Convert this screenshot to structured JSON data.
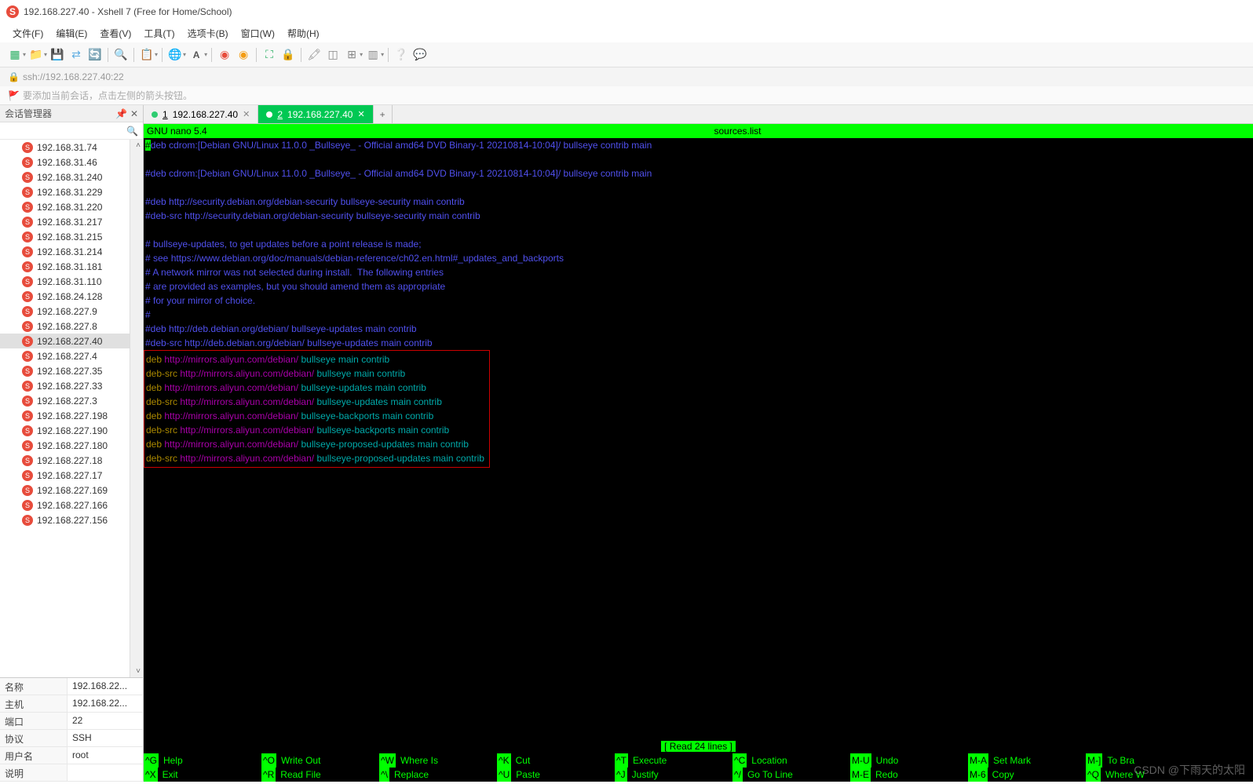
{
  "window": {
    "title": "192.168.227.40 - Xshell 7 (Free for Home/School)"
  },
  "menus": [
    "文件(F)",
    "编辑(E)",
    "查看(V)",
    "工具(T)",
    "选项卡(B)",
    "窗口(W)",
    "帮助(H)"
  ],
  "address": "ssh://192.168.227.40:22",
  "infobar": "要添加当前会话，点击左侧的箭头按钮。",
  "sidebar": {
    "title": "会话管理器",
    "items": [
      "192.168.227.156",
      "192.168.227.166",
      "192.168.227.169",
      "192.168.227.17",
      "192.168.227.18",
      "192.168.227.180",
      "192.168.227.190",
      "192.168.227.198",
      "192.168.227.3",
      "192.168.227.33",
      "192.168.227.35",
      "192.168.227.4",
      "192.168.227.40",
      "192.168.227.8",
      "192.168.227.9",
      "192.168.24.128",
      "192.168.31.110",
      "192.168.31.181",
      "192.168.31.214",
      "192.168.31.215",
      "192.168.31.217",
      "192.168.31.220",
      "192.168.31.229",
      "192.168.31.240",
      "192.168.31.46",
      "192.168.31.74"
    ],
    "selected_index": 12
  },
  "props": {
    "name_k": "名称",
    "name_v": "192.168.22...",
    "host_k": "主机",
    "host_v": "192.168.22...",
    "port_k": "端口",
    "port_v": "22",
    "proto_k": "协议",
    "proto_v": "SSH",
    "user_k": "用户名",
    "user_v": "root",
    "desc_k": "说明",
    "desc_v": ""
  },
  "tabs": [
    {
      "num": "1",
      "label": "192.168.227.40",
      "active": false
    },
    {
      "num": "2",
      "label": "192.168.227.40",
      "active": true
    }
  ],
  "nano": {
    "header_left": "  GNU nano 5.4",
    "header_center": "sources.list",
    "status": "[ Read 24 lines ]",
    "comments": [
      "deb cdrom:[Debian GNU/Linux 11.0.0 _Bullseye_ - Official amd64 DVD Binary-1 20210814-10:04]/ bullseye contrib main",
      "",
      "#deb cdrom:[Debian GNU/Linux 11.0.0 _Bullseye_ - Official amd64 DVD Binary-1 20210814-10:04]/ bullseye contrib main",
      "",
      "#deb http://security.debian.org/debian-security bullseye-security main contrib",
      "#deb-src http://security.debian.org/debian-security bullseye-security main contrib",
      "",
      "# bullseye-updates, to get updates before a point release is made;",
      "# see https://www.debian.org/doc/manuals/debian-reference/ch02.en.html#_updates_and_backports",
      "# A network mirror was not selected during install.  The following entries",
      "# are provided as examples, but you should amend them as appropriate",
      "# for your mirror of choice.",
      "#",
      "#deb http://deb.debian.org/debian/ bullseye-updates main contrib",
      "#deb-src http://deb.debian.org/debian/ bullseye-updates main contrib"
    ],
    "entries": [
      {
        "k": "deb",
        "u": "http://mirrors.aliyun.com/debian/",
        "s": "bullseye",
        "r": "main contrib"
      },
      {
        "k": "deb-src",
        "u": "http://mirrors.aliyun.com/debian/",
        "s": "bullseye",
        "r": "main contrib"
      },
      {
        "k": "deb",
        "u": "http://mirrors.aliyun.com/debian/",
        "s": "bullseye-updates",
        "r": "main contrib"
      },
      {
        "k": "deb-src",
        "u": "http://mirrors.aliyun.com/debian/",
        "s": "bullseye-updates",
        "r": "main contrib"
      },
      {
        "k": "deb",
        "u": "http://mirrors.aliyun.com/debian/",
        "s": "bullseye-backports",
        "r": "main contrib"
      },
      {
        "k": "deb-src",
        "u": "http://mirrors.aliyun.com/debian/",
        "s": "bullseye-backports",
        "r": "main contrib"
      },
      {
        "k": "deb",
        "u": "http://mirrors.aliyun.com/debian/",
        "s": "bullseye-proposed-updates",
        "r": "main contrib"
      },
      {
        "k": "deb-src",
        "u": "http://mirrors.aliyun.com/debian/",
        "s": "bullseye-proposed-updates",
        "r": "main contrib"
      }
    ],
    "footer": [
      [
        {
          "k": "^G",
          "l": "Help"
        },
        {
          "k": "^O",
          "l": "Write Out"
        },
        {
          "k": "^W",
          "l": "Where Is"
        },
        {
          "k": "^K",
          "l": "Cut"
        },
        {
          "k": "^T",
          "l": "Execute"
        },
        {
          "k": "^C",
          "l": "Location"
        },
        {
          "k": "M-U",
          "l": "Undo"
        },
        {
          "k": "M-A",
          "l": "Set Mark"
        },
        {
          "k": "M-]",
          "l": "To Bra"
        }
      ],
      [
        {
          "k": "^X",
          "l": "Exit"
        },
        {
          "k": "^R",
          "l": "Read File"
        },
        {
          "k": "^\\",
          "l": "Replace"
        },
        {
          "k": "^U",
          "l": "Paste"
        },
        {
          "k": "^J",
          "l": "Justify"
        },
        {
          "k": "^/",
          "l": "Go To Line"
        },
        {
          "k": "M-E",
          "l": "Redo"
        },
        {
          "k": "M-6",
          "l": "Copy"
        },
        {
          "k": "^Q",
          "l": "Where W"
        }
      ]
    ]
  },
  "watermark": "CSDN @下雨天的太阳"
}
